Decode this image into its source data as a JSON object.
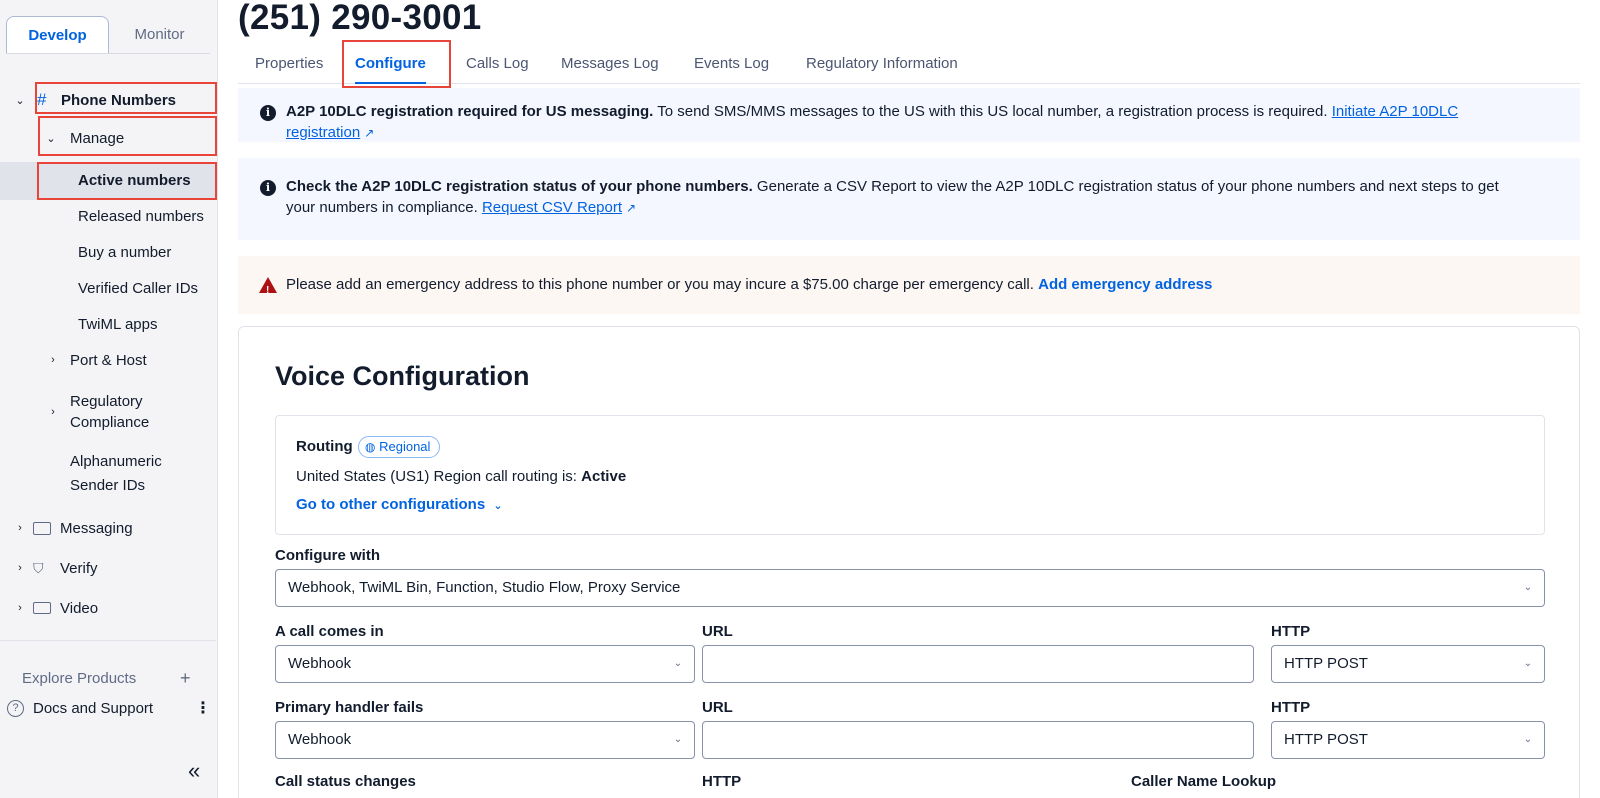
{
  "sidebar": {
    "tabs": [
      {
        "label": "Develop",
        "active": true
      },
      {
        "label": "Monitor",
        "active": false
      }
    ],
    "phone_numbers": "Phone Numbers",
    "manage": "Manage",
    "manage_items": [
      "Active numbers",
      "Released numbers",
      "Buy a number",
      "Verified Caller IDs",
      "TwiML apps"
    ],
    "port_host": "Port & Host",
    "regulatory": "Regulatory Compliance",
    "regulatory_1": "Regulatory",
    "regulatory_2": "Compliance",
    "alphanumeric_1": "Alphanumeric",
    "alphanumeric_2": "Sender IDs",
    "messaging": "Messaging",
    "verify": "Verify",
    "video": "Video",
    "explore": "Explore Products",
    "docs": "Docs and Support",
    "collapse_glyph": "«"
  },
  "page": {
    "title": "(251) 290-3001",
    "tabs": [
      "Properties",
      "Configure",
      "Calls Log",
      "Messages Log",
      "Events Log",
      "Regulatory Information"
    ],
    "active_tab": "Configure"
  },
  "banners": {
    "a2p": {
      "bold": "A2P 10DLC registration required for US messaging.",
      "text": " To send SMS/MMS messages to the US with this US local number, a registration process is required. ",
      "link": "Initiate A2P 10DLC registration"
    },
    "status": {
      "bold": "Check the A2P 10DLC registration status of your phone numbers.",
      "text": " Generate a CSV Report to view the A2P 10DLC registration status of your phone numbers and next steps to get your numbers in compliance. ",
      "link": "Request CSV Report"
    },
    "emergency": {
      "text": "Please add an emergency address to this phone number or you may incure a $75.00 charge per emergency call. ",
      "link": "Add emergency address"
    }
  },
  "voice": {
    "title": "Voice Configuration",
    "routing_label": "Routing",
    "routing_badge": "Regional",
    "routing_status_prefix": "United States (US1) Region call routing is: ",
    "routing_status_value": "Active",
    "other_config_link": "Go to other configurations",
    "configure_with_label": "Configure with",
    "configure_with_value": "Webhook, TwiML Bin, Function, Studio Flow, Proxy Service",
    "call_comes_in_label": "A call comes in",
    "call_comes_in_value": "Webhook",
    "url_label": "URL",
    "http_label": "HTTP",
    "http_value": "HTTP POST",
    "primary_fails_label": "Primary handler fails",
    "primary_fails_value": "Webhook",
    "call_status_label": "Call status changes",
    "caller_name_label": "Caller Name Lookup"
  },
  "colors": {
    "accent": "#0263e0",
    "highlight": "#e8443a",
    "warning": "#ad1111"
  }
}
